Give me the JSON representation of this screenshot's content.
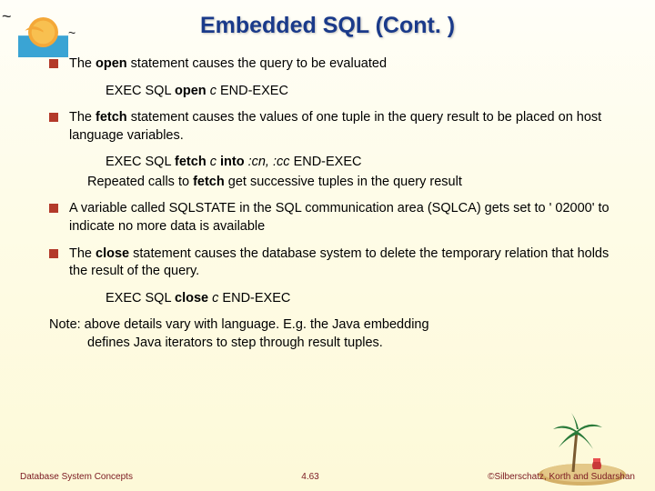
{
  "title": "Embedded SQL (Cont. )",
  "bullets": {
    "b1_pre": "The ",
    "b1_bold": "open",
    "b1_post": " statement causes the query to be evaluated",
    "code1_a": "EXEC SQL ",
    "code1_b": "open ",
    "code1_c": "c ",
    "code1_d": "END-EXEC",
    "b2_pre": "The ",
    "b2_bold": "fetch",
    "b2_post": " statement causes the values of one tuple in the query result to be placed on host language variables.",
    "code2_a": "EXEC SQL ",
    "code2_b": "fetch ",
    "code2_c": "c ",
    "code2_d": "into",
    "code2_e": " :cn, :cc ",
    "code2_f": "END-EXEC",
    "sub2_pre": "Repeated calls to ",
    "sub2_bold": "fetch",
    "sub2_post": " get successive tuples in the query result",
    "b3": "A variable called SQLSTATE in the SQL communication area (SQLCA) gets set to ' 02000' to indicate no more data is available",
    "b4_pre": "The ",
    "b4_bold": "close",
    "b4_post": " statement causes the database system to delete the temporary relation that holds the result of the query.",
    "code4_a": "EXEC SQL ",
    "code4_b": "close ",
    "code4_c": "c ",
    "code4_d": "END-EXEC",
    "note1": "Note: above details vary with language.  E.g. the Java embedding",
    "note2": "defines Java iterators to step through result tuples."
  },
  "footer": {
    "left": "Database System Concepts",
    "center": "4.63",
    "right": "©Silberschatz, Korth and Sudarshan"
  }
}
